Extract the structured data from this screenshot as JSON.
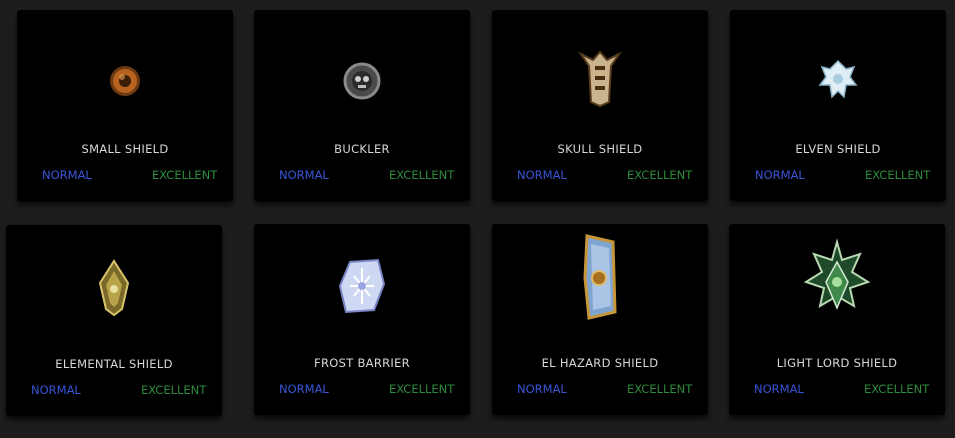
{
  "colors": {
    "normal": "#3a55d8",
    "excellent": "#2e8a3c",
    "card_bg": "#000000",
    "page_bg": "#1e1d1c"
  },
  "items": [
    {
      "name": "SMALL SHIELD",
      "normal": "NORMAL",
      "excellent": "EXCELLENT",
      "icon": "small-shield-icon"
    },
    {
      "name": "BUCKLER",
      "normal": "NORMAL",
      "excellent": "EXCELLENT",
      "icon": "buckler-icon"
    },
    {
      "name": "SKULL SHIELD",
      "normal": "NORMAL",
      "excellent": "EXCELLENT",
      "icon": "skull-shield-icon"
    },
    {
      "name": "ELVEN SHIELD",
      "normal": "NORMAL",
      "excellent": "EXCELLENT",
      "icon": "elven-shield-icon"
    },
    {
      "name": "ELEMENTAL SHIELD",
      "normal": "NORMAL",
      "excellent": "EXCELLENT",
      "icon": "elemental-shield-icon"
    },
    {
      "name": "FROST BARRIER",
      "normal": "NORMAL",
      "excellent": "EXCELLENT",
      "icon": "frost-barrier-icon"
    },
    {
      "name": "EL HAZARD SHIELD",
      "normal": "NORMAL",
      "excellent": "EXCELLENT",
      "icon": "el-hazard-shield-icon"
    },
    {
      "name": "LIGHT LORD SHIELD",
      "normal": "NORMAL",
      "excellent": "EXCELLENT",
      "icon": "light-lord-shield-icon"
    }
  ]
}
